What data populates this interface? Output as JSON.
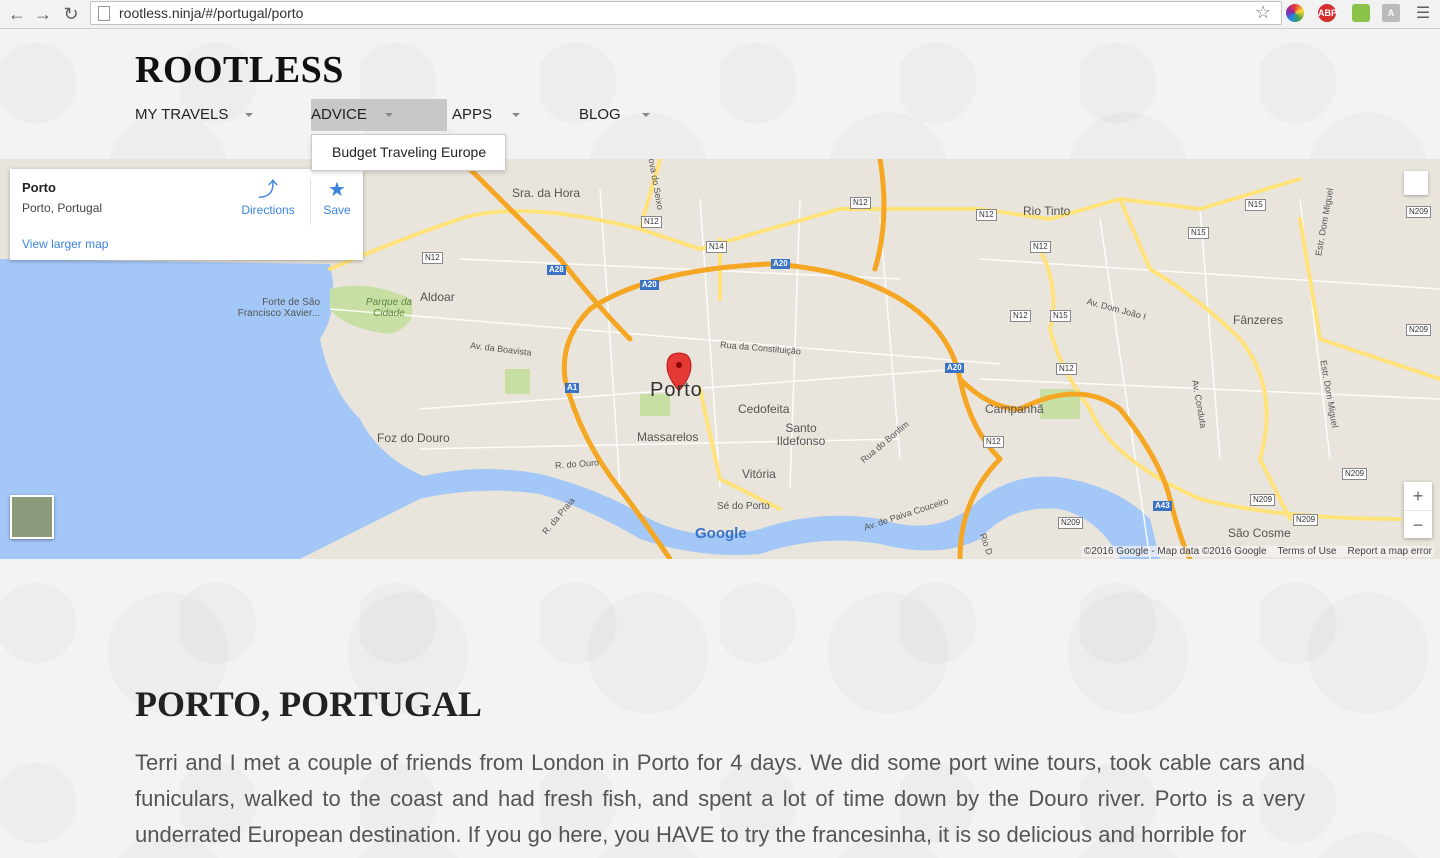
{
  "browser": {
    "url": "rootless.ninja/#/portugal/porto",
    "extensions": [
      "color-wheel-icon",
      "adblock-plus-icon",
      "eyedropper-icon",
      "translate-icon",
      "menu-icon"
    ],
    "abp_label": "ABP",
    "a_label": "A"
  },
  "site": {
    "logo": "ROOTLESS",
    "menu": [
      {
        "label": "MY TRAVELS"
      },
      {
        "label": "ADVICE"
      },
      {
        "label": "APPS"
      },
      {
        "label": "BLOG"
      }
    ],
    "dropdown_item": "Budget Traveling Europe"
  },
  "map": {
    "place_name": "Porto",
    "place_address": "Porto, Portugal",
    "directions_label": "Directions",
    "save_label": "Save",
    "view_larger": "View larger map",
    "zoom_in": "+",
    "zoom_out": "−",
    "attribution": "©2016 Google - Map data ©2016 Google",
    "terms": "Terms of Use",
    "report": "Report a map error",
    "google": "Google",
    "labels": {
      "porto": "Porto",
      "sra_da_hora": "Sra. da Hora",
      "aldoar": "Aldoar",
      "parque_da_cidade": "Parque da Cidade",
      "forte": "Forte de São Francisco Xavier...",
      "av_boavista": "Av. da Boavista",
      "foz": "Foz do Douro",
      "massarelos": "Massarelos",
      "cedofeita": "Cedofeita",
      "santo": "Santo Ildefonso",
      "vitoria": "Vitória",
      "se_do_porto": "Sé do Porto",
      "rio_tinto": "Rio Tinto",
      "campanha": "Campanhã",
      "fanzeres": "Fânzeres",
      "sao_cosme": "São Cosme",
      "rua_constituicao": "Rua da Constituição",
      "r_do_ouro": "R. do Ouro",
      "r_da_praia": "R. da Praia",
      "rua_bonfim": "Rua do Bonfim",
      "av_paiva": "Av. de Paiva Couceiro",
      "av_dom_joao": "Av. Dom João I",
      "av_conduta": "Av. Conduta",
      "estr_dom_miguel": "Estr. Dom Miguel",
      "ova_seixo": "ova do Seixo",
      "rio_d": "Rio D"
    },
    "shields": {
      "n12": "N12",
      "n14": "N14",
      "n15": "N15",
      "n209": "N209",
      "a20": "A20",
      "a28": "A28",
      "a1": "A1",
      "a43": "A43"
    }
  },
  "article": {
    "title": "PORTO, PORTUGAL",
    "body": "Terri and I met a couple of friends from London in Porto for 4 days. We did some port wine tours, took cable cars and funiculars, walked to the coast and had fresh fish, and spent a lot of time down by the Douro river. Porto is a very underrated European destination. If you go here, you HAVE to try the francesinha, it is so delicious and horrible for"
  },
  "colors": {
    "water": "#a3c7f7",
    "land": "#e9e5dc",
    "highway": "#f5a623",
    "road": "#ffe27a",
    "park": "#c8dfa4",
    "link": "#3a84df"
  }
}
